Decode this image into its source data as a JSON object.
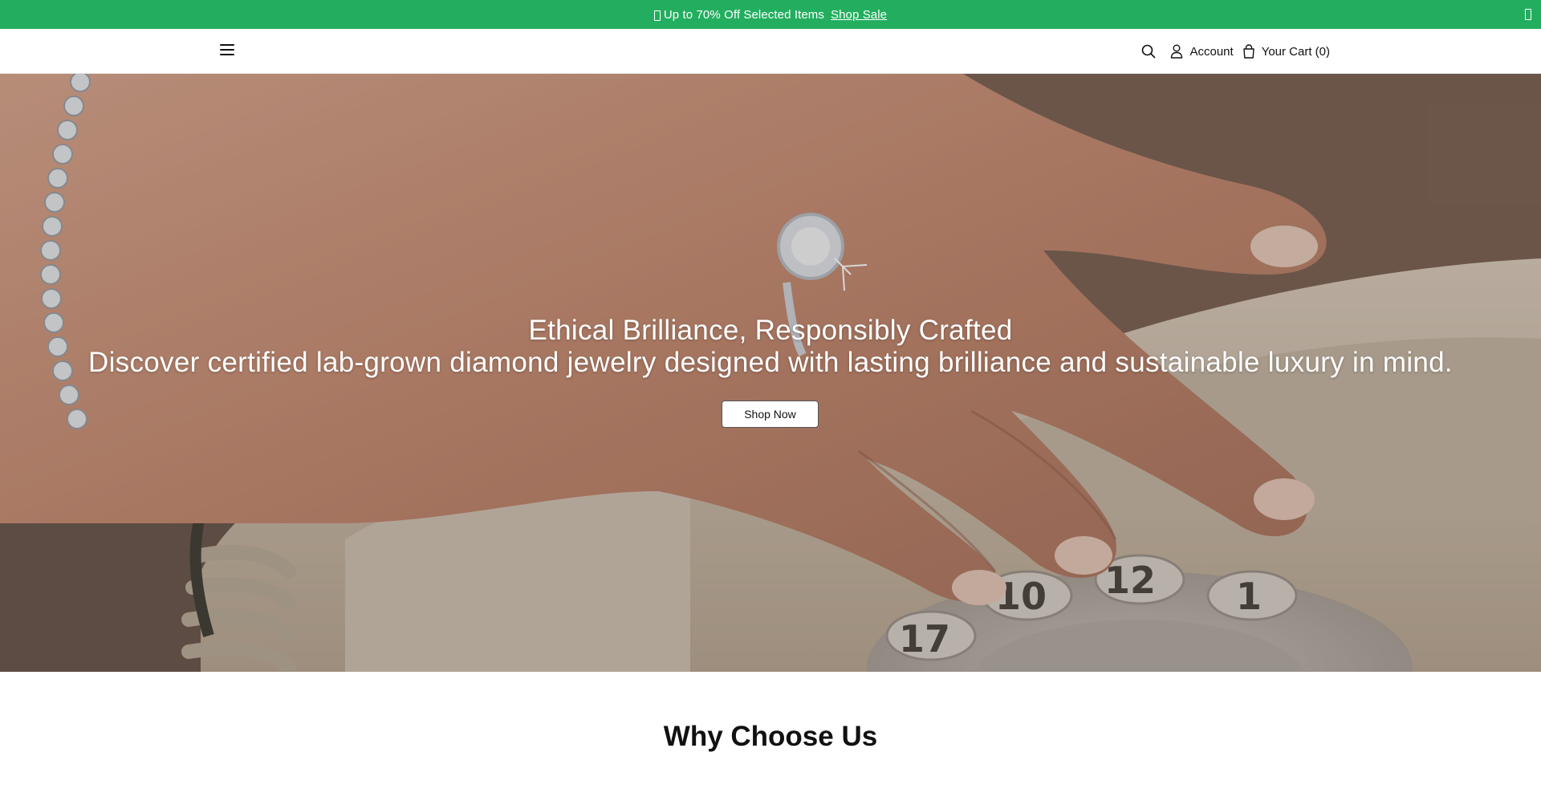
{
  "announcement": {
    "message": "Up to 70% Off Selected Items",
    "link": "Shop Sale"
  },
  "header": {
    "account_label": "Account",
    "cart_label": "Your Cart (0)"
  },
  "hero": {
    "title": "Ethical Brilliance, Responsibly Crafted",
    "subtitle": "Discover certified lab-grown diamond jewelry designed with lasting brilliance and sustainable luxury in mind.",
    "button_label": "Shop Now"
  },
  "sections": {
    "why_title": "Why Choose Us"
  },
  "colors": {
    "announcement_bg": "#23ae5f",
    "hero_skin": "#c9957b",
    "phone_beige": "#cdbfae"
  },
  "icons": [
    "gift-icon",
    "close-icon",
    "menu-icon",
    "search-icon",
    "account-icon",
    "cart-icon"
  ]
}
